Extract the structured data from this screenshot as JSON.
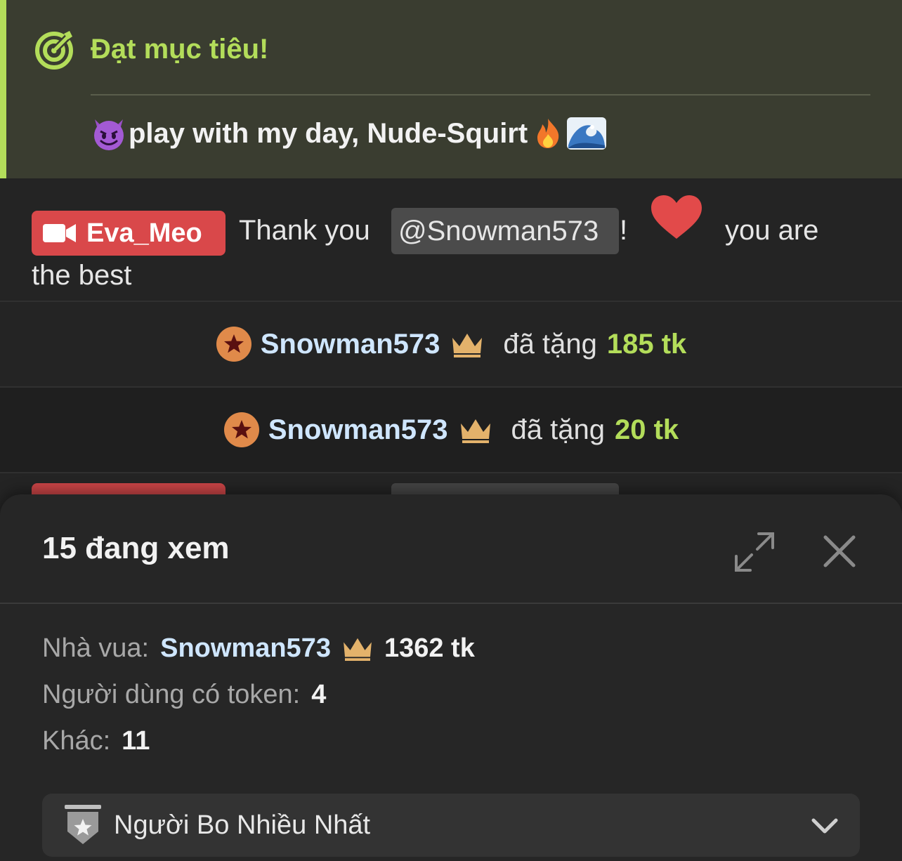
{
  "goal": {
    "title": "Đạt mục tiêu!",
    "text": "play with my day, Nude-Squirt",
    "accent_color": "#b3dd5a",
    "icons": [
      "target-icon",
      "devil-emoji",
      "fire-emoji",
      "wave-emoji"
    ]
  },
  "chat": {
    "message": {
      "sender": "Eva_Meo",
      "text_before": "Thank you",
      "mention": "@Snowman573",
      "exclamation": "!",
      "text_after": "you are",
      "text_wrap": "the best",
      "badge_color": "#d9484a"
    },
    "tips": [
      {
        "user": "Snowman573",
        "verb": "đã tặng",
        "amount": "185 tk"
      },
      {
        "user": "Snowman573",
        "verb": "đã tặng",
        "amount": "20 tk"
      }
    ]
  },
  "sheet": {
    "title": "15 đang xem",
    "king_label": "Nhà vua:",
    "king_name": "Snowman573",
    "king_amount": "1362 tk",
    "token_users_label": "Người dùng có token:",
    "token_users_value": "4",
    "others_label": "Khác:",
    "others_value": "11",
    "dropdown_label": "Người Bo Nhiều Nhất"
  }
}
